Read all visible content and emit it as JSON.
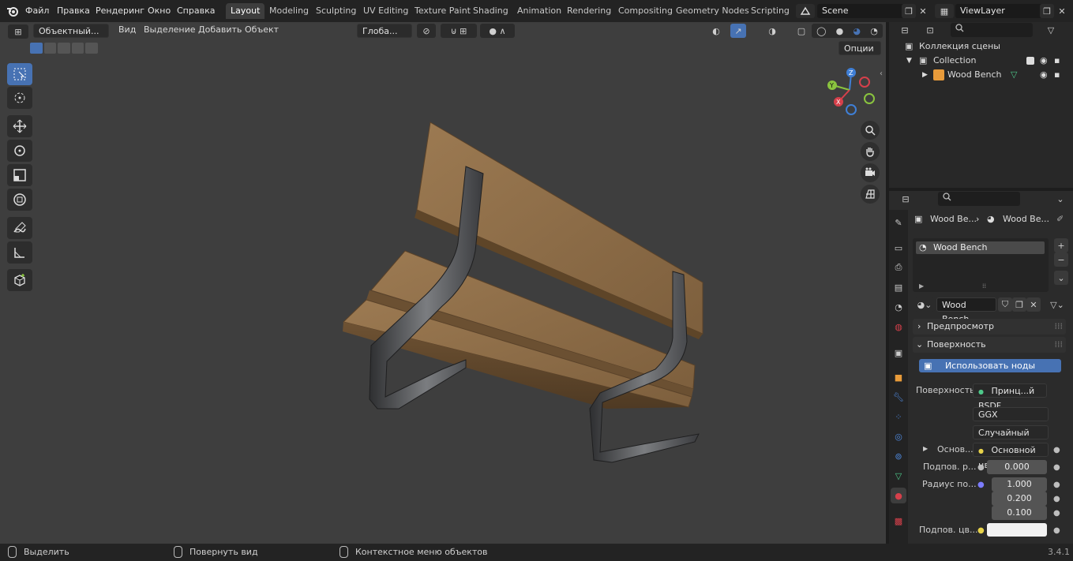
{
  "menu": {
    "file": "Файл",
    "edit": "Правка",
    "render": "Рендеринг",
    "window": "Окно",
    "help": "Справка"
  },
  "workspaces": [
    "Layout",
    "Modeling",
    "Sculpting",
    "UV Editing",
    "Texture Paint",
    "Shading",
    "Animation",
    "Rendering",
    "Compositing",
    "Geometry Nodes",
    "Scripting"
  ],
  "scene": {
    "name": "Scene",
    "view_layer": "ViewLayer"
  },
  "viewport_header": {
    "mode": "Объектный...",
    "view": "Вид",
    "select": "Выделение",
    "add": "Добавить",
    "object": "Объект",
    "orientation": "Глоба...",
    "options": "Опции"
  },
  "outliner": {
    "scene_collection": "Коллекция сцены",
    "collection": "Collection",
    "object": "Wood Bench"
  },
  "properties": {
    "breadcrumb_object": "Wood Be...",
    "breadcrumb_material": "Wood Be...",
    "material_slot": "Wood Bench",
    "material_name": "Wood Bench",
    "preview_section": "Предпросмотр",
    "surface_section": "Поверхность",
    "use_nodes_button": "Использовать ноды",
    "surface_label": "Поверхность",
    "surface_value": "Принц...й BSDF",
    "distribution": "GGX",
    "subsurface_method": "Случайный об...",
    "base_label": "Основ...",
    "base_value": "Основной цвет",
    "subsurface_label": "Подпов. р...",
    "subsurface_value": "0.000",
    "radius_label": "Радиус по...",
    "radius_values": [
      "1.000",
      "0.200",
      "0.100"
    ],
    "subsurface_color_label": "Подпов. цв..."
  },
  "statusbar": {
    "select": "Выделить",
    "rotate": "Повернуть вид",
    "context": "Контекстное меню объектов",
    "version": "3.4.1"
  },
  "colors": {
    "accent": "#4772b3",
    "viewport_bg": "#3e3e3e",
    "wood": "#8b6b45",
    "metal": "#5a5b5e",
    "axis_x": "#d6404b",
    "axis_y": "#8ac43f",
    "axis_z": "#3f7fd6"
  },
  "icons": [
    "blender-logo-icon",
    "cursor-icon",
    "move-icon",
    "rotate-icon",
    "scale-icon",
    "transform-icon",
    "annotate-icon",
    "measure-icon",
    "add-cube-icon",
    "zoom-icon",
    "hand-icon",
    "camera-icon",
    "grid-icon"
  ]
}
